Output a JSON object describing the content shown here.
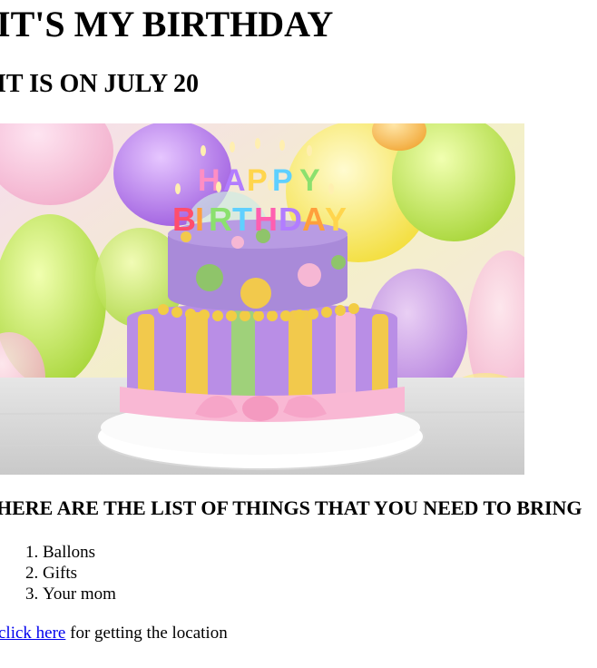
{
  "header": {
    "title": "IT'S MY BIRTHDAY",
    "subtitle": "IT IS ON JULY 20"
  },
  "image": {
    "cake_text_line1": "HAPPY",
    "cake_text_line2": "BIRTHDAY"
  },
  "list_section": {
    "heading": "HERE ARE THE LIST OF THINGS THAT YOU NEED TO BRING",
    "items": [
      "Ballons",
      "Gifts",
      "Your mom"
    ]
  },
  "location": {
    "link_text": "click here",
    "suffix": " for getting the location"
  },
  "colors": {
    "link": "#0000ee",
    "text": "#000000",
    "background": "#ffffff"
  }
}
